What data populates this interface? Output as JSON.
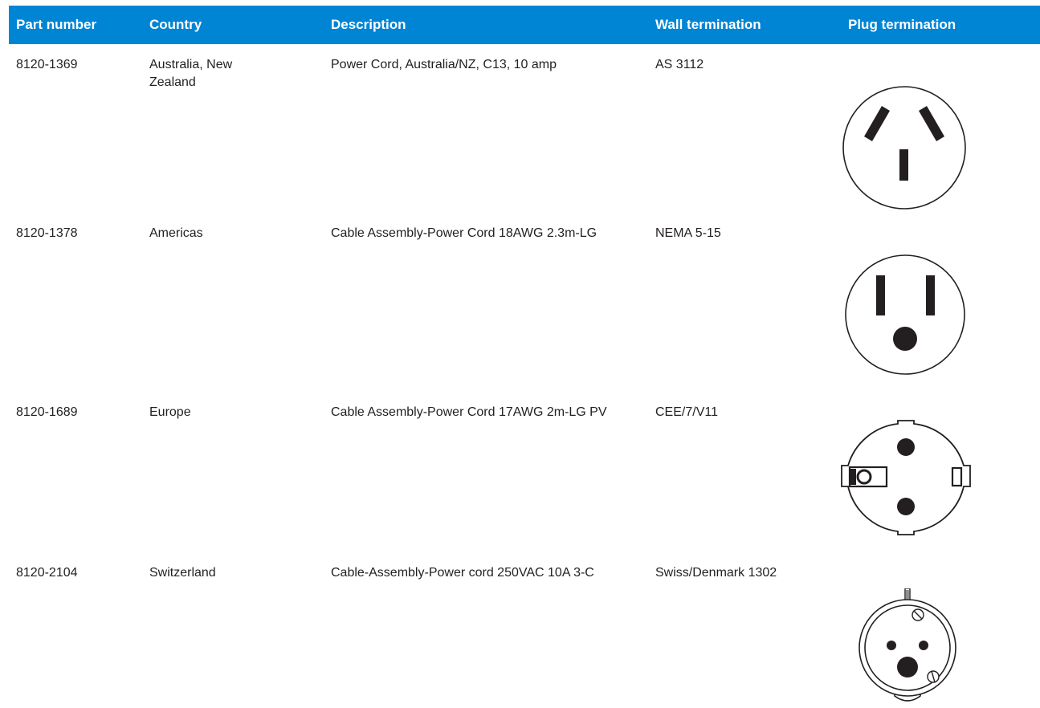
{
  "header": {
    "part_number": "Part number",
    "country": "Country",
    "description": "Description",
    "wall_termination": "Wall termination",
    "plug_termination": "Plug termination"
  },
  "rows": [
    {
      "part_number": "8120-1369",
      "country": "Australia, New Zealand",
      "description": "Power Cord, Australia/NZ, C13, 10 amp",
      "wall_termination": "AS 3112",
      "plug_icon": "australia-plug-icon"
    },
    {
      "part_number": "8120-1378",
      "country": "Americas",
      "description": "Cable Assembly-Power Cord 18AWG 2.3m-LG",
      "wall_termination": "NEMA 5-15",
      "plug_icon": "nema-5-15-plug-icon"
    },
    {
      "part_number": "8120-1689",
      "country": "Europe",
      "description": "Cable Assembly-Power Cord 17AWG 2m-LG PV",
      "wall_termination": "CEE/7/V11",
      "plug_icon": "cee-7-plug-icon"
    },
    {
      "part_number": "8120-2104",
      "country": "Switzerland",
      "description": "Cable-Assembly-Power cord 250VAC 10A 3-C",
      "wall_termination": "Swiss/Denmark 1302",
      "plug_icon": "swiss-plug-icon"
    }
  ],
  "colors": {
    "header_bg": "#0085d5",
    "header_text": "#ffffff",
    "body_text": "#231f20"
  }
}
